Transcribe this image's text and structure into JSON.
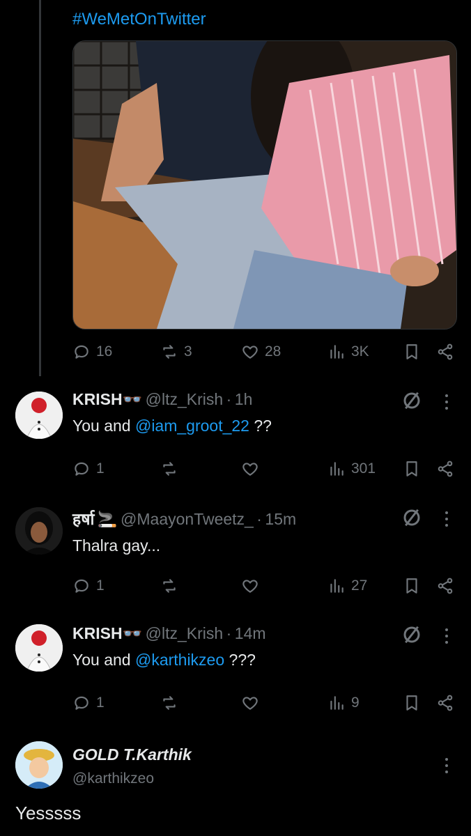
{
  "post": {
    "hashtag": "#WeMetOnTwitter",
    "stats": {
      "replies": "16",
      "reposts": "3",
      "likes": "28",
      "views": "3K"
    }
  },
  "replies": [
    {
      "name": "KRISH",
      "name_emoji": "👓",
      "handle": "@ltz_Krish",
      "sep": "·",
      "time": "1h",
      "text_prefix": "You and ",
      "mention": "@iam_groot_22",
      "text_suffix": " ??",
      "stats": {
        "replies": "1",
        "reposts": "",
        "likes": "",
        "views": "301"
      }
    },
    {
      "name": "हर्षा",
      "name_emoji": "🚬",
      "handle": "@MaayonTweetz_",
      "sep": "·",
      "time": "15m",
      "text_prefix": "Thalra gay...",
      "mention": "",
      "text_suffix": "",
      "stats": {
        "replies": "1",
        "reposts": "",
        "likes": "",
        "views": "27"
      }
    },
    {
      "name": "KRISH",
      "name_emoji": "👓",
      "handle": "@ltz_Krish",
      "sep": "·",
      "time": "14m",
      "text_prefix": "You and ",
      "mention": "@karthikzeo",
      "text_suffix": " ???",
      "stats": {
        "replies": "1",
        "reposts": "",
        "likes": "",
        "views": "9"
      }
    }
  ],
  "main_reply": {
    "name": "GOLD T.Karthik",
    "handle": "@karthikzeo",
    "text": "Yesssss"
  },
  "colors": {
    "accent": "#1d9bf0",
    "muted": "#71767b",
    "text": "#e7e9ea",
    "bg": "#000000"
  },
  "icons": [
    "reply-icon",
    "repost-icon",
    "like-icon",
    "views-icon",
    "bookmark-icon",
    "share-icon",
    "grok-icon",
    "more-icon"
  ]
}
